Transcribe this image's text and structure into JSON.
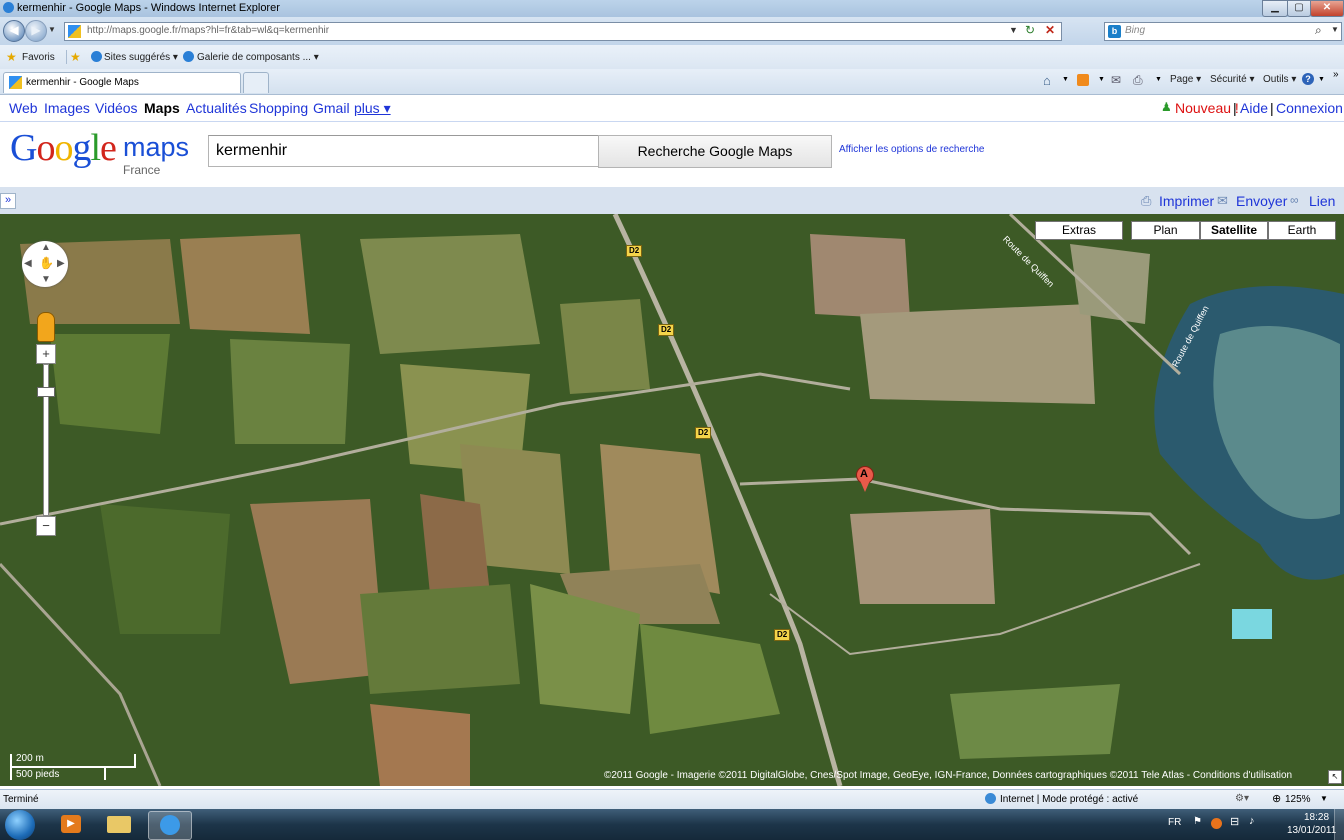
{
  "window": {
    "title": "kermenhir - Google Maps - Windows Internet Explorer",
    "minimize": "▁",
    "maximize": "▢",
    "close": "✕"
  },
  "browser": {
    "url": "http://maps.google.fr/maps?hl=fr&tab=wl&q=kermenhir",
    "search_placeholder": "Bing",
    "favorites": {
      "label": "Favoris",
      "items": [
        "Sites suggérés ▾",
        "Galerie de composants ... ▾"
      ]
    },
    "tab_title": "kermenhir - Google Maps",
    "commands": [
      "Page ▾",
      "Sécurité ▾",
      "Outils ▾"
    ]
  },
  "gbar": {
    "links": [
      "Web",
      "Images",
      "Vidéos",
      "Maps",
      "Actualités",
      "Shopping",
      "Gmail",
      "plus ▾"
    ],
    "active": "Maps",
    "right": {
      "nouveau": "Nouveau !",
      "aide": "Aide",
      "connexion": "Connexion",
      "sep": "|"
    }
  },
  "logo": {
    "google": "Google",
    "maps": "maps",
    "country": "France"
  },
  "search": {
    "value": "kermenhir",
    "button": "Recherche Google Maps",
    "options_link": "Afficher les options de recherche"
  },
  "toolbar": {
    "expand": "»",
    "print": "Imprimer",
    "send": "Envoyer",
    "link": "Lien"
  },
  "map": {
    "types": [
      "Extras",
      "Plan",
      "Satellite",
      "Earth"
    ],
    "selected_type": "Satellite",
    "road_label": "D2",
    "marker": "A",
    "scale": {
      "metric": "200 m",
      "imperial": "500 pieds"
    },
    "copyright": "©2011 Google - Imagerie ©2011 DigitalGlobe, Cnes/Spot Image, GeoEye, IGN-France, Données cartographiques ©2011 Tele Atlas - Conditions d'utilisation",
    "road_names": [
      "Route de Quiffen",
      "Route de Quiffen"
    ],
    "zoom_in": "+",
    "zoom_out": "−"
  },
  "statusbar": {
    "status": "Terminé",
    "zone": "Internet | Mode protégé : activé",
    "zoom": "125%"
  },
  "taskbar": {
    "lang": "FR",
    "time": "18:28",
    "date": "13/01/2011"
  }
}
